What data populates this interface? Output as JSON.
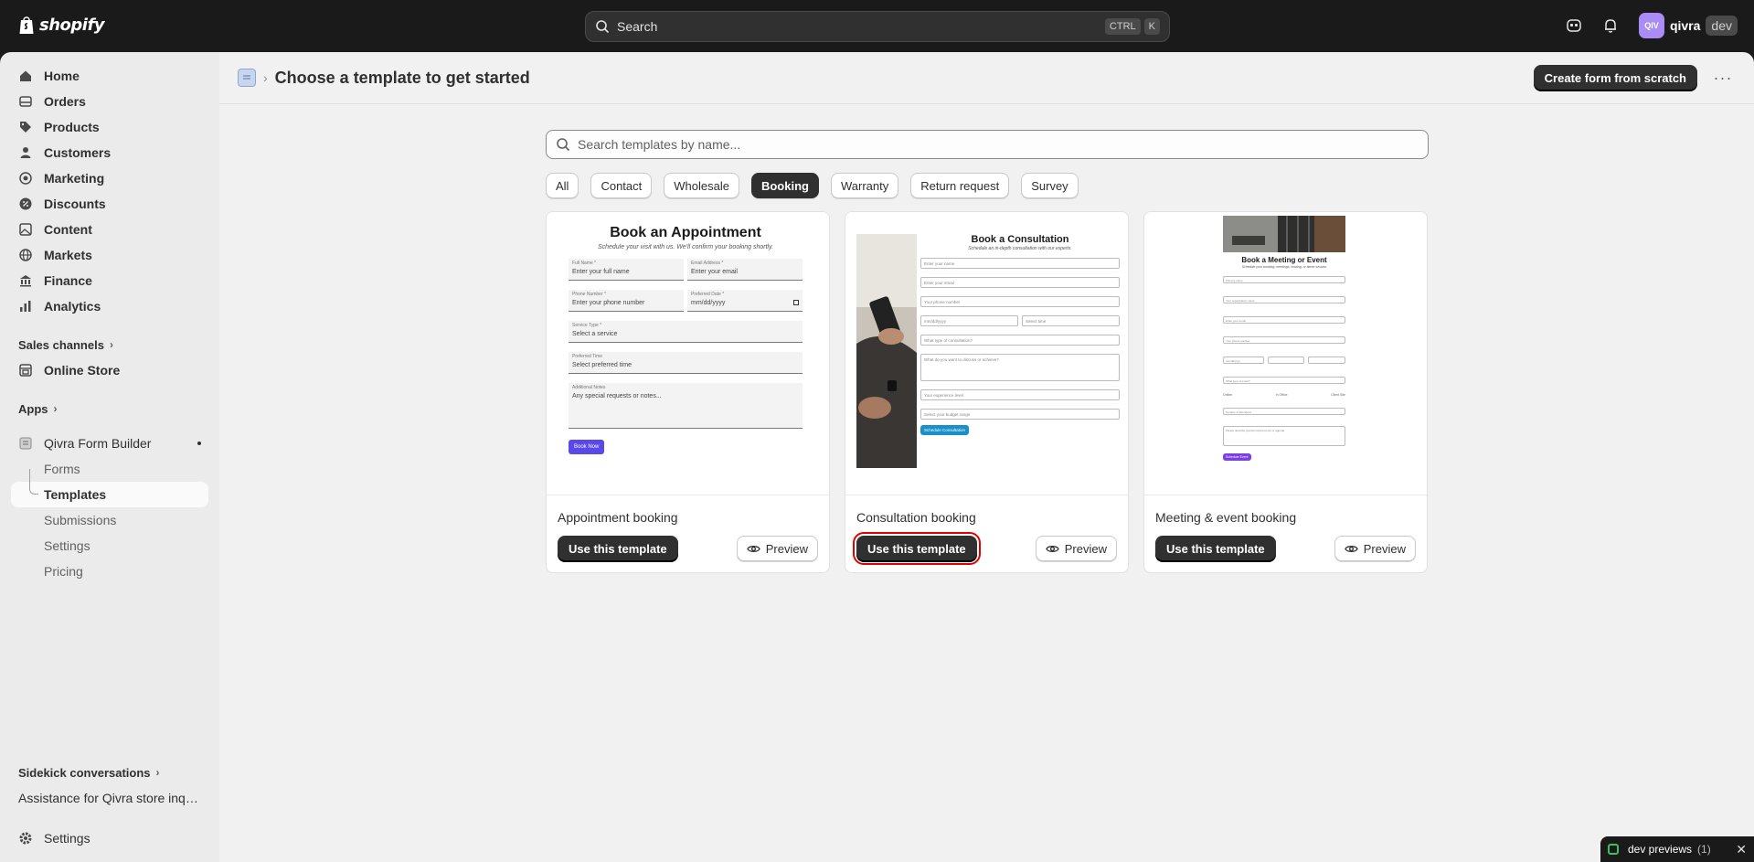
{
  "topbar": {
    "brand": "shopify",
    "search_label": "Search",
    "kbd1": "CTRL",
    "kbd2": "K",
    "avatar_initials": "QIV",
    "store_name": "qivra",
    "env_badge": "dev"
  },
  "sidebar": {
    "items": [
      {
        "label": "Home",
        "icon": "home-icon"
      },
      {
        "label": "Orders",
        "icon": "orders-icon"
      },
      {
        "label": "Products",
        "icon": "tag-icon"
      },
      {
        "label": "Customers",
        "icon": "person-icon"
      },
      {
        "label": "Marketing",
        "icon": "target-icon"
      },
      {
        "label": "Discounts",
        "icon": "discount-icon"
      },
      {
        "label": "Content",
        "icon": "content-icon"
      },
      {
        "label": "Markets",
        "icon": "globe-icon"
      },
      {
        "label": "Finance",
        "icon": "bank-icon"
      },
      {
        "label": "Analytics",
        "icon": "chart-icon"
      }
    ],
    "sales_channels_label": "Sales channels",
    "online_store_label": "Online Store",
    "apps_label": "Apps",
    "app_name": "Qivra Form Builder",
    "app_sub_items": [
      "Forms",
      "Templates",
      "Submissions",
      "Settings",
      "Pricing"
    ],
    "sidekick_label": "Sidekick conversations",
    "sidekick_conversation": "Assistance for Qivra store inqu...",
    "settings_label": "Settings"
  },
  "header": {
    "title": "Choose a template to get started",
    "create_button": "Create form from scratch"
  },
  "search": {
    "placeholder": "Search templates by name..."
  },
  "filters": [
    "All",
    "Contact",
    "Wholesale",
    "Booking",
    "Warranty",
    "Return request",
    "Survey"
  ],
  "selected_filter": "Booking",
  "cards": [
    {
      "title": "Appointment booking",
      "use_label": "Use this template",
      "preview_label": "Preview",
      "thumb": {
        "heading": "Book an Appointment",
        "subheading": "Schedule your visit with us. We'll confirm your booking shortly.",
        "f1_label": "Full Name *",
        "f1_value": "Enter your full name",
        "f2_label": "Email Address *",
        "f2_value": "Enter your email",
        "f3_label": "Phone Number *",
        "f3_value": "Enter your phone number",
        "f4_label": "Preferred Date *",
        "f4_value": "mm/dd/yyyy",
        "f5_label": "Service Type *",
        "f5_value": "Select a service",
        "f6_label": "Preferred Time",
        "f6_value": "Select preferred time",
        "f7_label": "Additional Notes",
        "f7_value": "Any special requests or notes...",
        "button": "Book Now",
        "button_color": "#5a48e8"
      }
    },
    {
      "title": "Consultation booking",
      "use_label": "Use this template",
      "preview_label": "Preview",
      "thumb": {
        "heading": "Book a Consultation",
        "subheading": "Schedule an in-depth consultation with our experts.",
        "fields": [
          "Enter your name",
          "Enter your email",
          "Your phone number",
          "mm/dd/yyyy",
          "Select time",
          "What type of consultation?",
          "What do you want to discuss or achieve?",
          "Your experience level",
          "Select your budget range"
        ],
        "button": "Schedule Consultation",
        "button_color": "#1b8fc7"
      }
    },
    {
      "title": "Meeting & event booking",
      "use_label": "Use this template",
      "preview_label": "Preview",
      "thumb": {
        "heading": "Book a Meeting or Event",
        "subheading": "Schedule your booking, meetings, hosting, or demo session",
        "fields": [
          "Primary name",
          "Your organization name",
          "Enter your email",
          "Your phone number",
          "mm/dd/yyyy",
          "What type of event?",
          "Number of attendees",
          "Please describe special requirements or agenda"
        ],
        "option_a": "Online",
        "option_b": "In Office",
        "option_c": "Client Site",
        "button": "Schedule Event",
        "button_color": "#7b3fe4"
      }
    }
  ],
  "dev_bar": {
    "label": "dev previews",
    "count": "(1)"
  },
  "colors": {
    "topbar": "#1a1a1a",
    "sidebar": "#ebebeb",
    "main": "#f1f1f1",
    "primary_button": "#303030",
    "highlight": "#e00000"
  }
}
